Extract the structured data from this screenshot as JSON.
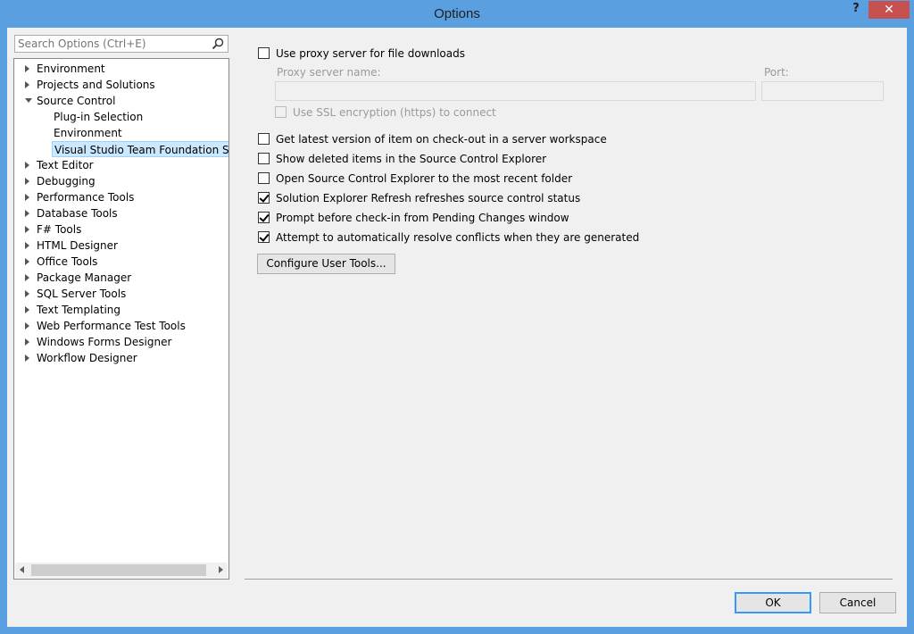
{
  "window": {
    "title": "Options",
    "help_label": "?",
    "close_label": "✕"
  },
  "search": {
    "placeholder": "Search Options (Ctrl+E)"
  },
  "tree": {
    "items": [
      {
        "label": "Environment",
        "level": 0,
        "state": "collapsed"
      },
      {
        "label": "Projects and Solutions",
        "level": 0,
        "state": "collapsed"
      },
      {
        "label": "Source Control",
        "level": 0,
        "state": "expanded"
      },
      {
        "label": "Plug-in Selection",
        "level": 1,
        "state": "leaf"
      },
      {
        "label": "Environment",
        "level": 1,
        "state": "leaf"
      },
      {
        "label": "Visual Studio Team Foundation Server",
        "level": 1,
        "state": "leaf",
        "selected": true
      },
      {
        "label": "Text Editor",
        "level": 0,
        "state": "collapsed"
      },
      {
        "label": "Debugging",
        "level": 0,
        "state": "collapsed"
      },
      {
        "label": "Performance Tools",
        "level": 0,
        "state": "collapsed"
      },
      {
        "label": "Database Tools",
        "level": 0,
        "state": "collapsed"
      },
      {
        "label": "F# Tools",
        "level": 0,
        "state": "collapsed"
      },
      {
        "label": "HTML Designer",
        "level": 0,
        "state": "collapsed"
      },
      {
        "label": "Office Tools",
        "level": 0,
        "state": "collapsed"
      },
      {
        "label": "Package Manager",
        "level": 0,
        "state": "collapsed"
      },
      {
        "label": "SQL Server Tools",
        "level": 0,
        "state": "collapsed"
      },
      {
        "label": "Text Templating",
        "level": 0,
        "state": "collapsed"
      },
      {
        "label": "Web Performance Test Tools",
        "level": 0,
        "state": "collapsed"
      },
      {
        "label": "Windows Forms Designer",
        "level": 0,
        "state": "collapsed"
      },
      {
        "label": "Workflow Designer",
        "level": 0,
        "state": "collapsed"
      }
    ]
  },
  "proxy": {
    "use_proxy_label": "Use proxy server for file downloads",
    "use_proxy_checked": false,
    "server_name_label": "Proxy server name:",
    "server_name_value": "",
    "port_label": "Port:",
    "port_value": "",
    "ssl_label": "Use SSL encryption (https) to connect",
    "ssl_checked": false
  },
  "options": [
    {
      "label": "Get latest version of item on check-out in a server workspace",
      "checked": false
    },
    {
      "label": "Show deleted items in the Source Control Explorer",
      "checked": false
    },
    {
      "label": "Open Source Control Explorer to the most recent folder",
      "checked": false
    },
    {
      "label": "Solution Explorer Refresh refreshes source control status",
      "checked": true
    },
    {
      "label": "Prompt before check-in from Pending Changes window",
      "checked": true
    },
    {
      "label": "Attempt to automatically resolve conflicts when they are generated",
      "checked": true
    }
  ],
  "configure_button": "Configure User Tools...",
  "footer": {
    "ok_label": "OK",
    "cancel_label": "Cancel"
  }
}
